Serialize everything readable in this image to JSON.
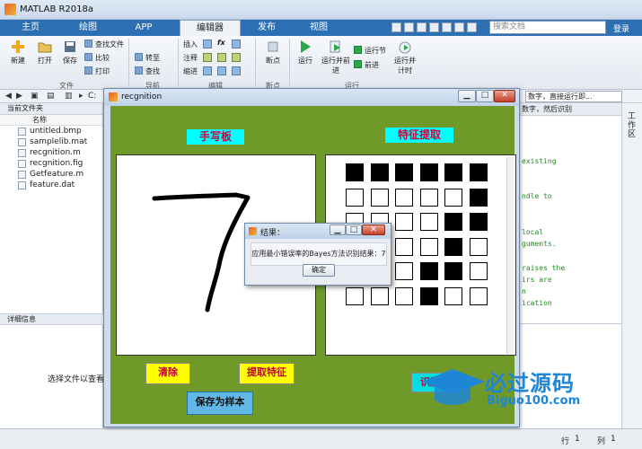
{
  "window": {
    "title": "MATLAB R2018a"
  },
  "tabs": [
    {
      "label": "主页"
    },
    {
      "label": "绘图"
    },
    {
      "label": "APP"
    },
    {
      "label": "编辑器"
    },
    {
      "label": "发布"
    },
    {
      "label": "视图"
    }
  ],
  "search": {
    "placeholder": "搜索文档"
  },
  "login": "登录",
  "ribbon": {
    "new": "新建",
    "open": "打开",
    "save": "保存",
    "find_files": "查找文件",
    "compare": "比较",
    "print": "打印",
    "goto": "转至",
    "find": "查找",
    "insert": "插入",
    "comment": "注释",
    "indent": "缩进",
    "breakpoints": "断点",
    "run": "运行",
    "run_advance": "运行并前进",
    "run_section": "运行节",
    "advance": "前进",
    "run_time": "运行并计时",
    "groups": {
      "file": "文件",
      "nav": "导航",
      "edit": "编辑",
      "bp": "断点",
      "run": "运行"
    }
  },
  "address": {
    "path": "C:",
    "cmd_hint": "数字，直接运行即..."
  },
  "left": {
    "current_folder": "当前文件夹",
    "name_col": "名称",
    "files": [
      "untitled.bmp",
      "samplelib.mat",
      "recgnition.m",
      "recgnition.fig",
      "Getfeature.m",
      "feature.dat"
    ],
    "details_header": "详细信息",
    "details_text": "选择文件以查看详"
  },
  "editor": {
    "header": "数字，然后识别",
    "lines": [
      "existing",
      "ndle to",
      "local",
      "guments.",
      "raises the",
      "irs are",
      "n",
      "ication"
    ]
  },
  "sidebar_right": "工作区",
  "status": {
    "row_label": "行",
    "row": "1",
    "col_label": "列",
    "col": "1"
  },
  "figure": {
    "title": "recgnition",
    "handwriting_label": "手写板",
    "feature_label": "特征提取",
    "clear_button": "清除",
    "extract_button": "提取特征",
    "save_sample_button": "保存为样本",
    "recognize_button": "识别",
    "feature_grid": [
      [
        1,
        1,
        1,
        1,
        1,
        1
      ],
      [
        0,
        0,
        0,
        0,
        0,
        1
      ],
      [
        0,
        0,
        0,
        0,
        1,
        1
      ],
      [
        0,
        0,
        0,
        0,
        1,
        0
      ],
      [
        0,
        0,
        0,
        1,
        1,
        0
      ],
      [
        0,
        0,
        0,
        1,
        0,
        0
      ]
    ]
  },
  "dialog": {
    "title": "结果：",
    "message": "应用最小错误率的Bayes方法识别结果：7",
    "ok": "确定"
  },
  "watermark": {
    "text": "必过源码",
    "sub": "Biguo100.com"
  }
}
